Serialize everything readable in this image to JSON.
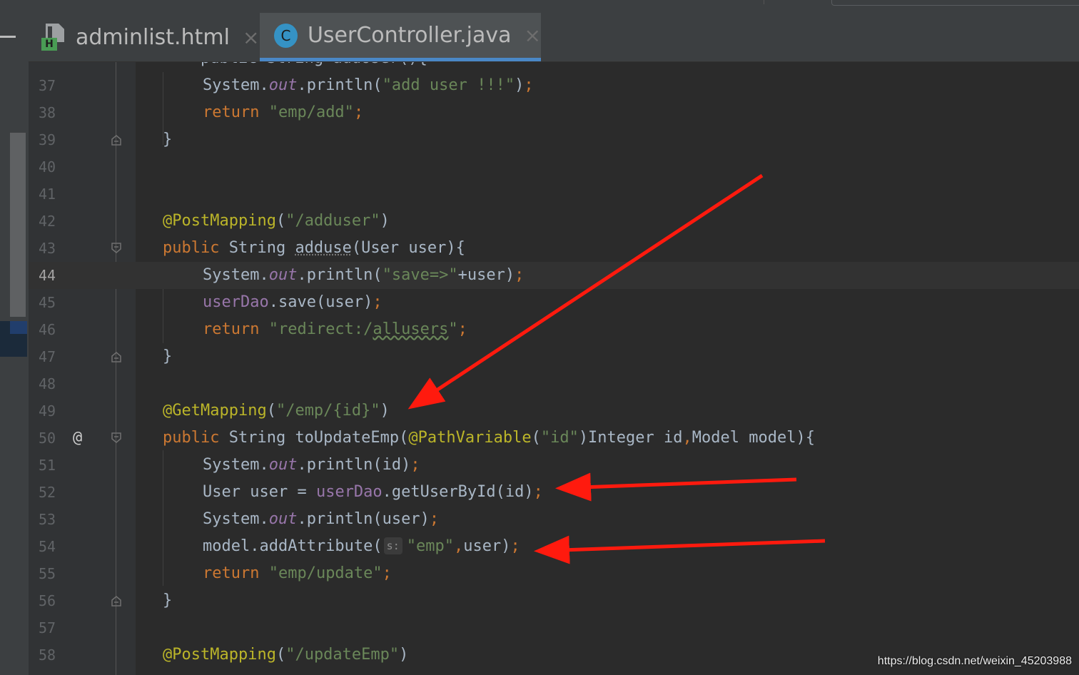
{
  "tabs": [
    {
      "label": "adminlist.html",
      "icon": "html-file-icon",
      "badge": "H",
      "active": false
    },
    {
      "label": "UserController.java",
      "icon": "java-class-icon",
      "badge": "C",
      "active": true
    }
  ],
  "close_glyph": "×",
  "gutter_marker": "@",
  "parameter_hint": "s:",
  "clipped_top_line": "    public String addUser(){",
  "line_numbers": [
    "37",
    "38",
    "39",
    "40",
    "41",
    "42",
    "43",
    "44",
    "45",
    "46",
    "47",
    "48",
    "49",
    "50",
    "51",
    "52",
    "53",
    "54",
    "55",
    "56",
    "57",
    "58"
  ],
  "current_line": "44",
  "code": {
    "l37": {
      "a": "System.",
      "b": "out",
      "c": ".println(",
      "d": "\"add user !!!\"",
      "e": ")",
      "f": ";"
    },
    "l38": {
      "a": "return ",
      "b": "\"emp/add\"",
      "c": ";"
    },
    "l39": {
      "a": "}"
    },
    "l42": {
      "a": "@PostMapping",
      "b": "(",
      "c": "\"/adduser\"",
      "d": ")"
    },
    "l43": {
      "a": "public ",
      "b": "String ",
      "c": "adduse",
      "d": "(User user){"
    },
    "l44": {
      "a": "System.",
      "b": "out",
      "c": ".println(",
      "d": "\"save=>\"",
      "e": "+user)",
      "f": ";"
    },
    "l45": {
      "a": "userDao",
      "b": ".save(user)",
      "c": ";"
    },
    "l46": {
      "a": "return ",
      "b": "\"redirect:/",
      "c": "allusers",
      "d": "\"",
      "e": ";"
    },
    "l47": {
      "a": "}"
    },
    "l49": {
      "a": "@GetMapping",
      "b": "(",
      "c": "\"/emp/{id}\"",
      "d": ")"
    },
    "l50": {
      "a": "public ",
      "b": "String ",
      "c": "toUpdateEmp(",
      "d": "@PathVariable",
      "e": "(",
      "f": "\"id\"",
      "g": ")Integer id",
      "h": ",",
      "i": "Model model){"
    },
    "l51": {
      "a": "System.",
      "b": "out",
      "c": ".println(id)",
      "d": ";"
    },
    "l52": {
      "a": "User user = ",
      "b": "userDao",
      "c": ".getUserById(id)",
      "d": ";"
    },
    "l53": {
      "a": "System.",
      "b": "out",
      "c": ".println(user)",
      "d": ";"
    },
    "l54": {
      "a": "model.addAttribute(",
      "b": "\"emp\"",
      "c": ",",
      "d": "user)",
      "e": ";"
    },
    "l55": {
      "a": "return ",
      "b": "\"emp/update\"",
      "c": ";"
    },
    "l56": {
      "a": "}"
    },
    "l58": {
      "a": "@PostMapping",
      "b": "(",
      "c": "\"/updateEmp\"",
      "d": ")"
    }
  },
  "colors": {
    "background": "#2b2b2b",
    "keyword": "#cc7832",
    "string": "#6a8759",
    "annotation": "#bbb529",
    "field": "#9876aa",
    "text": "#a9b7c6",
    "arrow": "#ff1a0e",
    "active_tab_underline": "#4a88c7"
  },
  "watermark": "https://blog.csdn.net/weixin_45203988"
}
